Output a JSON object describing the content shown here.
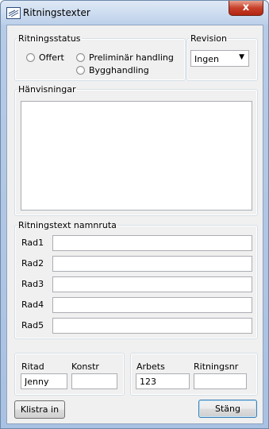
{
  "window": {
    "title": "Ritningstexter",
    "close_label": "x"
  },
  "status": {
    "legend": "Ritningsstatus",
    "options": [
      "Offert",
      "Preliminär handling",
      "Bygghandling"
    ]
  },
  "revision": {
    "legend": "Revision",
    "selected": "Ingen"
  },
  "references": {
    "legend": "Hänvisningar",
    "value": ""
  },
  "titleblock": {
    "legend": "Ritningstext namnruta",
    "rows": [
      {
        "label": "Rad1",
        "value": ""
      },
      {
        "label": "Rad2",
        "value": ""
      },
      {
        "label": "Rad3",
        "value": ""
      },
      {
        "label": "Rad4",
        "value": ""
      },
      {
        "label": "Rad5",
        "value": ""
      }
    ]
  },
  "people": {
    "drawn_label": "Ritad",
    "drawn_value": "Jenny",
    "design_label": "Konstr",
    "design_value": ""
  },
  "job": {
    "job_label": "Arbets",
    "job_value": "123",
    "drawing_label": "Ritningsnr",
    "drawing_value": ""
  },
  "buttons": {
    "paste": "Klistra in",
    "close": "Stäng"
  }
}
